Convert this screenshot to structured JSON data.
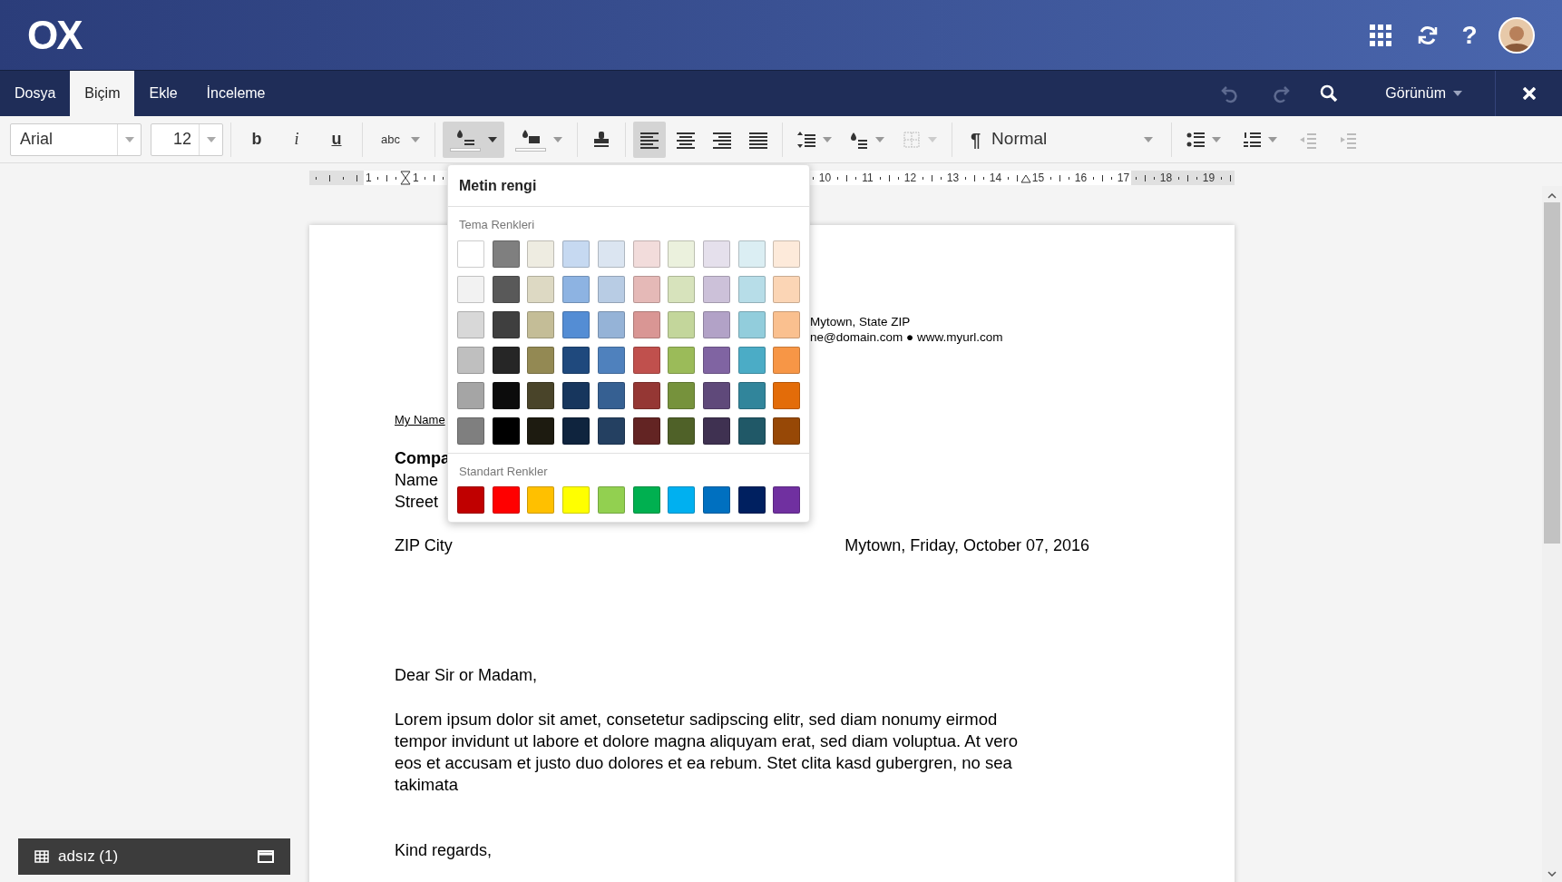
{
  "header": {
    "logo": "OX",
    "help": "?"
  },
  "menu_tabs": [
    {
      "label": "Dosya",
      "selected": false
    },
    {
      "label": "Biçim",
      "selected": true
    },
    {
      "label": "Ekle",
      "selected": false
    },
    {
      "label": "İnceleme",
      "selected": false
    }
  ],
  "menu_actions": [
    {
      "kind": "undo",
      "disabled": true
    },
    {
      "kind": "redo",
      "disabled": true
    },
    {
      "kind": "search",
      "disabled": false
    }
  ],
  "view_menu": "Görünüm",
  "toolbar": {
    "font": "Arial",
    "size": "12",
    "paragraph_mark": "¶",
    "style": "Normal",
    "groups": [
      [
        {
          "kind": "bold",
          "label": "b",
          "active": false,
          "disabled": false,
          "dropdown": false
        },
        {
          "kind": "italic",
          "label": "i",
          "active": false,
          "disabled": false,
          "dropdown": false
        },
        {
          "kind": "underline",
          "label": "u",
          "active": false,
          "disabled": false,
          "dropdown": false
        }
      ],
      [
        {
          "kind": "strike",
          "label": "abc",
          "active": false,
          "disabled": false,
          "dropdown": true
        }
      ],
      [
        {
          "kind": "text-color",
          "active": true,
          "disabled": false,
          "dropdown": true
        },
        {
          "kind": "highlight",
          "active": false,
          "disabled": false,
          "dropdown": true
        }
      ],
      [
        {
          "kind": "stamp",
          "active": false,
          "disabled": false,
          "dropdown": false
        }
      ],
      [
        {
          "kind": "align-left",
          "active": true,
          "disabled": false,
          "dropdown": false
        },
        {
          "kind": "align-center",
          "active": false,
          "disabled": false,
          "dropdown": false
        },
        {
          "kind": "align-right",
          "active": false,
          "disabled": false,
          "dropdown": false
        },
        {
          "kind": "justify",
          "active": false,
          "disabled": false,
          "dropdown": false
        }
      ],
      [
        {
          "kind": "line-spacing",
          "active": false,
          "disabled": false,
          "dropdown": true
        },
        {
          "kind": "paragraph-fill",
          "active": false,
          "disabled": false,
          "dropdown": true
        },
        {
          "kind": "borders",
          "active": false,
          "disabled": true,
          "dropdown": true
        }
      ]
    ],
    "list_groups": [
      [
        {
          "kind": "bullets",
          "active": false,
          "disabled": false,
          "dropdown": true
        },
        {
          "kind": "numbering",
          "active": false,
          "disabled": false,
          "dropdown": true
        },
        {
          "kind": "outdent",
          "active": false,
          "disabled": true,
          "dropdown": false
        },
        {
          "kind": "indent",
          "active": false,
          "disabled": true,
          "dropdown": false
        }
      ]
    ]
  },
  "ruler": {
    "left_labels": [
      "1",
      "1"
    ],
    "right_labels": [
      "10",
      "11",
      "12",
      "13",
      "14",
      "15",
      "16",
      "17",
      "18",
      "19"
    ]
  },
  "color_popup": {
    "title": "Metin rengi",
    "sections": [
      {
        "title": "Tema Renkleri",
        "swatches": [
          {
            "color": "#ffffff"
          },
          {
            "color": "#7f7f7f"
          },
          {
            "color": "#eeece1"
          },
          {
            "color": "#c6d9f1"
          },
          {
            "color": "#dbe5f1"
          },
          {
            "color": "#f2dcdb"
          },
          {
            "color": "#ebf1dd"
          },
          {
            "color": "#e5e0ec"
          },
          {
            "color": "#dbeef3"
          },
          {
            "color": "#fdeada"
          },
          {
            "color": "#f2f2f2"
          },
          {
            "color": "#595959"
          },
          {
            "color": "#ddd9c3"
          },
          {
            "color": "#8db3e2"
          },
          {
            "color": "#b8cce4"
          },
          {
            "color": "#e5b9b7"
          },
          {
            "color": "#d7e3bc"
          },
          {
            "color": "#ccc1d9"
          },
          {
            "color": "#b7dde8"
          },
          {
            "color": "#fbd5b5"
          },
          {
            "color": "#d8d8d8"
          },
          {
            "color": "#3f3f3f"
          },
          {
            "color": "#c4bd97"
          },
          {
            "color": "#548dd4"
          },
          {
            "color": "#95b3d7"
          },
          {
            "color": "#d99694"
          },
          {
            "color": "#c3d69b"
          },
          {
            "color": "#b2a2c7"
          },
          {
            "color": "#92cddc"
          },
          {
            "color": "#fac08f"
          },
          {
            "color": "#bfbfbf"
          },
          {
            "color": "#262626"
          },
          {
            "color": "#938953"
          },
          {
            "color": "#1f497d"
          },
          {
            "color": "#4f81bd"
          },
          {
            "color": "#c0504d"
          },
          {
            "color": "#9bbb59"
          },
          {
            "color": "#8064a2"
          },
          {
            "color": "#4bacc6"
          },
          {
            "color": "#f79646"
          },
          {
            "color": "#a5a5a5"
          },
          {
            "color": "#0c0c0c"
          },
          {
            "color": "#494429"
          },
          {
            "color": "#17365d"
          },
          {
            "color": "#366092"
          },
          {
            "color": "#953734"
          },
          {
            "color": "#76923c"
          },
          {
            "color": "#5f497a"
          },
          {
            "color": "#31859b"
          },
          {
            "color": "#e36c09"
          },
          {
            "color": "#7f7f7f"
          },
          {
            "color": "#000000"
          },
          {
            "color": "#1d1b10"
          },
          {
            "color": "#0f243e"
          },
          {
            "color": "#244061"
          },
          {
            "color": "#632423"
          },
          {
            "color": "#4f6128"
          },
          {
            "color": "#3f3151"
          },
          {
            "color": "#205867"
          },
          {
            "color": "#974806"
          }
        ]
      },
      {
        "title": "Standart Renkler",
        "swatches": [
          {
            "color": "#c00000"
          },
          {
            "color": "#ff0000"
          },
          {
            "color": "#ffc000"
          },
          {
            "color": "#ffff00"
          },
          {
            "color": "#92d050"
          },
          {
            "color": "#00b050"
          },
          {
            "color": "#00b0f0"
          },
          {
            "color": "#0070c0"
          },
          {
            "color": "#002060"
          },
          {
            "color": "#7030a0"
          }
        ]
      }
    ]
  },
  "document": {
    "header_lines": [
      "Mytown, State ZIP",
      "ne@domain.com ● www.myurl.com"
    ],
    "sender": "My Name",
    "recipient": [
      {
        "text": "Compa",
        "bold": true
      },
      {
        "text": "Name",
        "bold": false
      },
      {
        "text": "Street",
        "bold": false
      }
    ],
    "city": "ZIP City",
    "date": "Mytown, Friday, October 07, 2016",
    "salutation": "Dear Sir or Madam,",
    "body": "Lorem ipsum dolor sit amet, consetetur sadipscing elitr, sed diam nonumy eirmod tempor invidunt ut labore et dolore magna aliquyam erat, sed diam voluptua. At vero eos et accusam et justo duo dolores et ea rebum. Stet clita kasd gubergren, no sea takimata",
    "closing": "Kind regards,"
  },
  "taskbar": {
    "label": "adsız (1)"
  }
}
